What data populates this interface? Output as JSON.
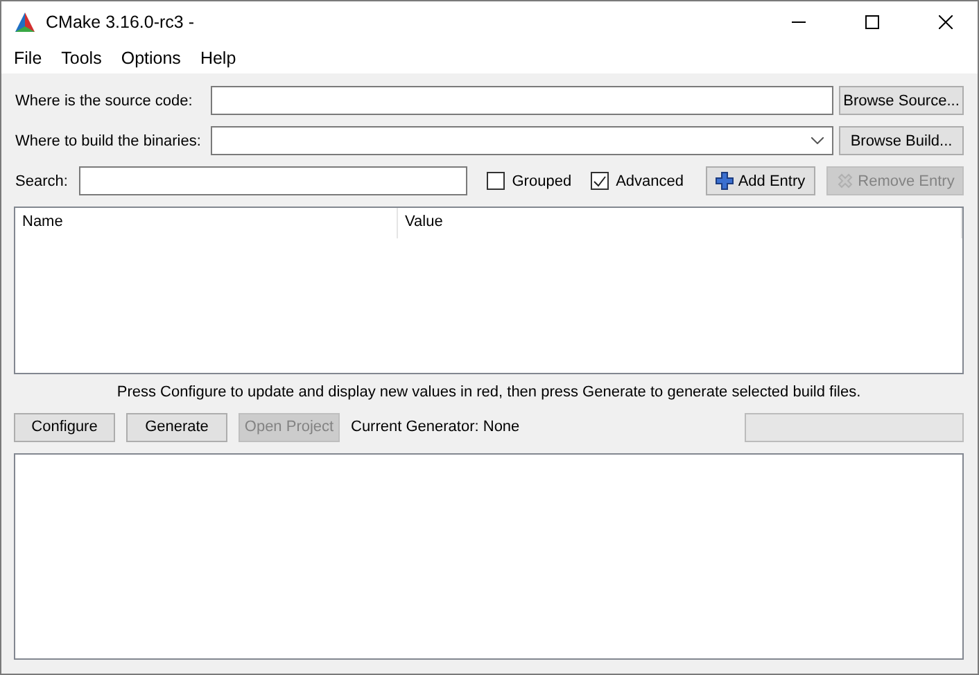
{
  "window": {
    "title": "CMake 3.16.0-rc3 -"
  },
  "menu": [
    "File",
    "Tools",
    "Options",
    "Help"
  ],
  "source": {
    "label": "Where is the source code:",
    "button": "Browse Source..."
  },
  "build": {
    "label": "Where to build the binaries:",
    "button": "Browse Build..."
  },
  "search": {
    "label": "Search:"
  },
  "options": [
    {
      "label": "Grouped",
      "checked": false
    },
    {
      "label": "Advanced",
      "checked": true
    }
  ],
  "entry_buttons": [
    {
      "label": "Add Entry",
      "kind": "add",
      "disabled": false
    },
    {
      "label": "Remove Entry",
      "kind": "remove",
      "disabled": true
    }
  ],
  "table": {
    "columns": [
      "Name",
      "Value"
    ]
  },
  "hint": "Press Configure to update and display new values in red, then press Generate to generate selected build files.",
  "actions": [
    {
      "label": "Configure",
      "disabled": false
    },
    {
      "label": "Generate",
      "disabled": false
    },
    {
      "label": "Open Project",
      "disabled": true
    }
  ],
  "generator": "Current Generator: None",
  "progress": {
    "level": 0
  }
}
